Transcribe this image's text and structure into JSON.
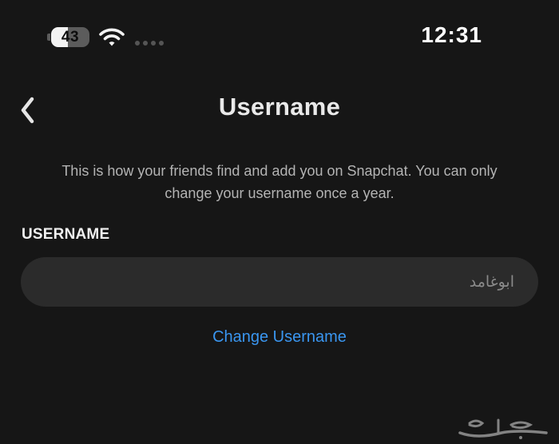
{
  "status_bar": {
    "battery_level": 43,
    "battery_label": "43",
    "time": "12:31",
    "icons": [
      "battery-icon",
      "wifi-icon",
      "cellular-signal-icon"
    ]
  },
  "nav": {
    "back_icon": "chevron-left-icon",
    "title": "Username"
  },
  "content": {
    "description": "This is how your friends find and add you on Snapchat. You can only change your username once a year.",
    "field_label": "USERNAME",
    "username_value": "ابوغامد",
    "change_link": "Change Username"
  },
  "watermark": {
    "text": "حراج"
  },
  "colors": {
    "background": "#161616",
    "input_background": "#2b2b2b",
    "link": "#3a96f0",
    "description": "#b4b4b4"
  }
}
